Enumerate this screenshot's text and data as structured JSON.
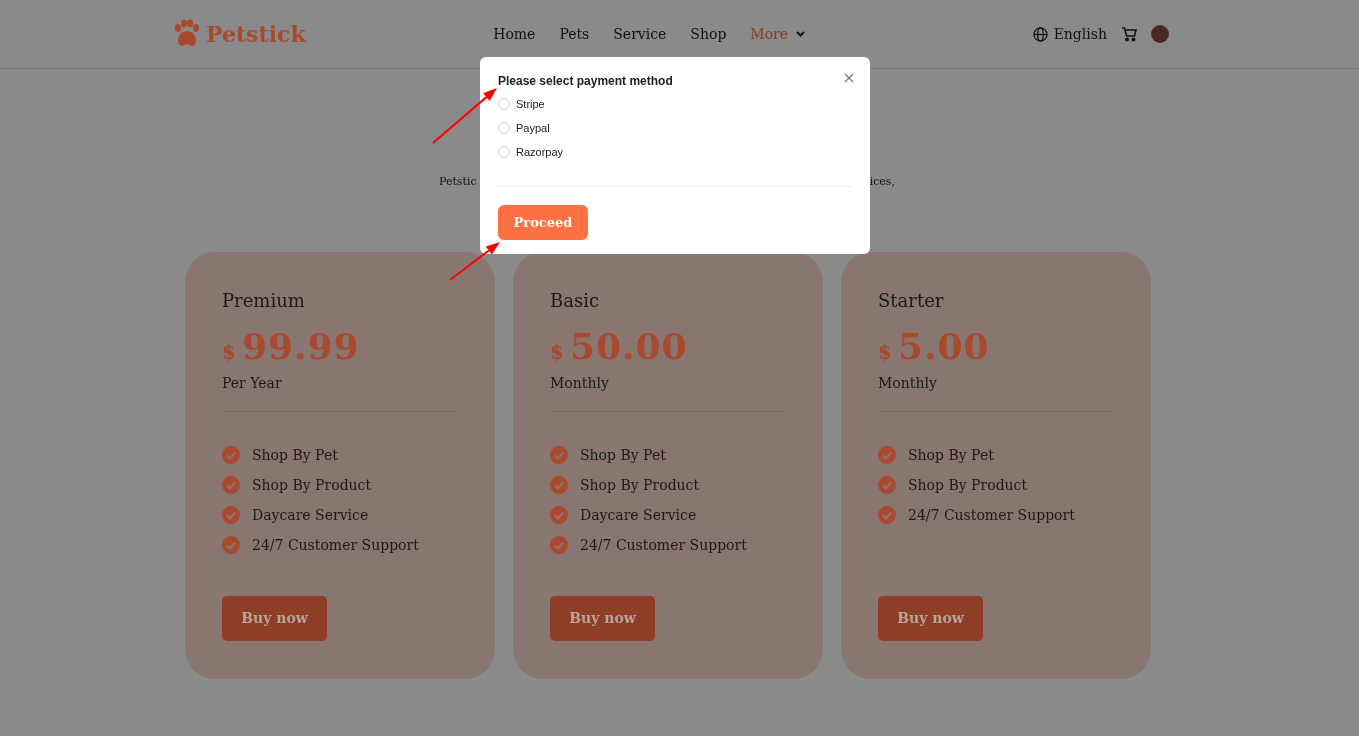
{
  "header": {
    "logo": "Petstick",
    "nav": [
      {
        "label": "Home",
        "selected": false
      },
      {
        "label": "Pets",
        "selected": false
      },
      {
        "label": "Service",
        "selected": false
      },
      {
        "label": "Shop",
        "selected": false
      },
      {
        "label": "More",
        "selected": true,
        "dropdown": true
      }
    ],
    "language": "English"
  },
  "hero": {
    "subtitle_start": "Petstic",
    "subtitle_end": "ices,"
  },
  "plans": [
    {
      "name": "Premium",
      "currency": "$",
      "price": "99.99",
      "period": "Per Year",
      "features": [
        "Shop By Pet",
        "Shop By Product",
        "Daycare Service",
        "24/7 Customer Support"
      ],
      "button": "Buy now"
    },
    {
      "name": "Basic",
      "currency": "$",
      "price": "50.00",
      "period": "Monthly",
      "features": [
        "Shop By Pet",
        "Shop By Product",
        "Daycare Service",
        "24/7 Customer Support"
      ],
      "button": "Buy now"
    },
    {
      "name": "Starter",
      "currency": "$",
      "price": "5.00",
      "period": "Monthly",
      "features": [
        "Shop By Pet",
        "Shop By Product",
        "24/7 Customer Support"
      ],
      "button": "Buy now"
    }
  ],
  "modal": {
    "title": "Please select payment method",
    "options": [
      {
        "label": "Stripe",
        "selected": false
      },
      {
        "label": "Paypal",
        "selected": false
      },
      {
        "label": "Razorpay",
        "selected": false
      }
    ],
    "button": "Proceed"
  }
}
